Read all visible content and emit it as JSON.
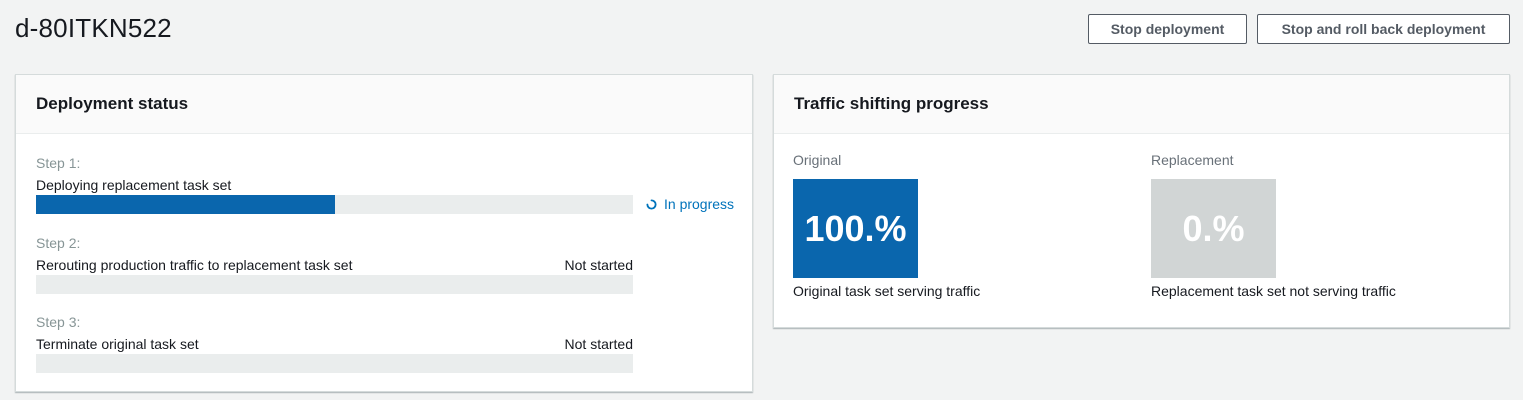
{
  "header": {
    "title": "d-80ITKN522",
    "stop_label": "Stop deployment",
    "rollback_label": "Stop and roll back deployment"
  },
  "deployment_status": {
    "title": "Deployment status",
    "steps": [
      {
        "label": "Step 1:",
        "description": "Deploying replacement task set",
        "status": "In progress",
        "progress_fraction": 0.5
      },
      {
        "label": "Step 2:",
        "description": "Rerouting production traffic to replacement task set",
        "status": "Not started",
        "progress_fraction": 0
      },
      {
        "label": "Step 3:",
        "description": "Terminate original task set",
        "status": "Not started",
        "progress_fraction": 0
      }
    ],
    "spinner_icon": "spinner-icon"
  },
  "traffic": {
    "title": "Traffic shifting progress",
    "original": {
      "label": "Original",
      "percent": "100.%",
      "caption": "Original task set serving traffic"
    },
    "replacement": {
      "label": "Replacement",
      "percent": "0.%",
      "caption": "Replacement task set not serving traffic"
    }
  },
  "colors": {
    "primary_blue": "#0a66ad",
    "link_blue": "#0073bb",
    "inactive_gray": "#d1d5d5",
    "track_gray": "#eaeded"
  }
}
